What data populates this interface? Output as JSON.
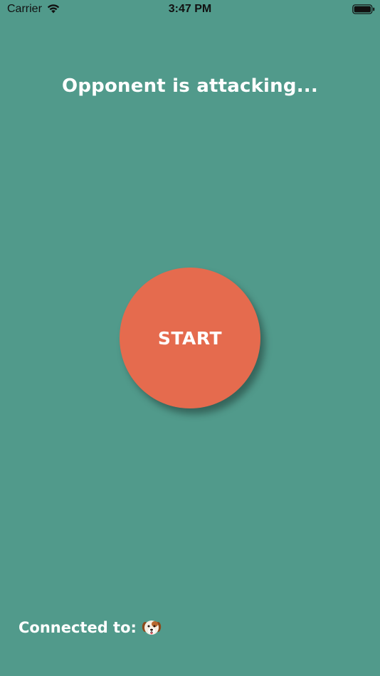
{
  "status_bar": {
    "carrier": "Carrier",
    "time": "3:47 PM",
    "wifi_icon": "wifi-icon",
    "battery_icon": "battery-full-icon"
  },
  "screen": {
    "title": "Opponent is attacking..."
  },
  "start_button": {
    "label": "START",
    "color": "#E56B4E"
  },
  "footer": {
    "connected_label": "Connected to:",
    "avatar_icon": "dog-face-icon"
  },
  "colors": {
    "background": "#519A8B",
    "text": "#FFFFFF",
    "button": "#E56B4E"
  }
}
